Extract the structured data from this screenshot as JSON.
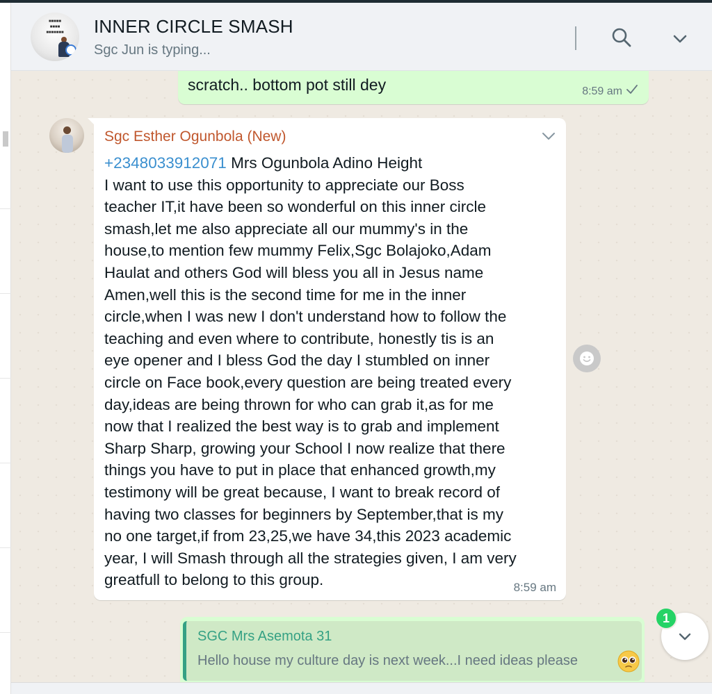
{
  "header": {
    "group_name": "INNER CIRCLE SMASH",
    "status": "Sgc Jun is typing..."
  },
  "messages": {
    "outgoing_top": {
      "text": "scratch.. bottom pot still dey",
      "time": "8:59 am"
    },
    "incoming": {
      "sender": "Sgc Esther Ogunbola (New)",
      "phone": "+2348033912071",
      "first_line_rest": " Mrs Ogunbola Adino Height",
      "lines": [
        "I want to use this opportunity to appreciate our Boss",
        "teacher IT,it have been so wonderful on this inner circle",
        "smash,let me also appreciate all our mummy's in the",
        "house,to mention few mummy Felix,Sgc Bolajoko,Adam",
        "Haulat and others God will bless you all in Jesus name",
        "Amen,well this is the second time for me in the inner",
        "circle,when I was new I don't understand how to follow the",
        "teaching and even where to contribute, honestly tis is an",
        "eye opener and I bless God the day I stumbled on inner",
        "circle on Face book,every question are being treated every",
        "day,ideas are being thrown for who can grab it,as for me",
        "now that I realized the best way is to grab and implement",
        "Sharp Sharp, growing your School I now realize that there",
        "things you have to put in place that enhanced growth,my",
        "testimony will be great because, I want to break record of",
        "having two classes for beginners by September,that is my",
        "no one target,if from 23,25,we have 34,this 2023 academic",
        "year, I will Smash through all the strategies given, I am very",
        "greatfull to belong to this group."
      ],
      "time": "8:59 am"
    },
    "outgoing_reply": {
      "quoted_name": "SGC Mrs Asemota 31",
      "quoted_text": "Hello house my culture day is next week...I need ideas please"
    }
  },
  "scroll": {
    "unread_count": "1"
  },
  "colors": {
    "outgoing_bubble": "#d9fdd3",
    "incoming_bubble": "#ffffff",
    "sender_name": "#c0572d",
    "phone_link": "#3a8fcf",
    "quote_accent": "#35a184",
    "unread_badge": "#25d366"
  },
  "icons": {
    "search": "search-icon",
    "menu": "chevron-down-icon",
    "read": "check-icon",
    "reaction": "smiley-icon",
    "scroll": "scroll-down-icon",
    "emoji": "pleading-face-emoji"
  }
}
